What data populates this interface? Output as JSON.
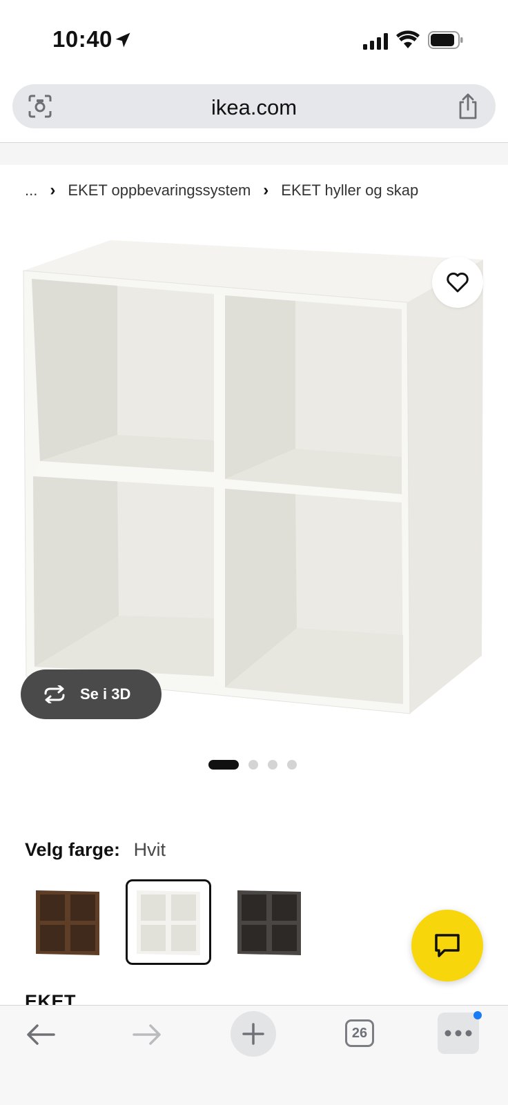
{
  "status_bar": {
    "time": "10:40"
  },
  "browser": {
    "url": "ikea.com",
    "tab_count": "26"
  },
  "breadcrumb": {
    "items": [
      "...",
      "EKET oppbevaringssystem",
      "EKET hyller og skap"
    ],
    "separator": "›"
  },
  "product": {
    "view_3d_label": "Se i 3D",
    "image_count": 4,
    "active_image": 1,
    "color_label": "Velg farge:",
    "color_value": "Hvit",
    "swatches": [
      {
        "name": "walnut",
        "color": "#5e3e27",
        "selected": false
      },
      {
        "name": "white",
        "color": "#ecebe6",
        "selected": true
      },
      {
        "name": "dark-grey",
        "color": "#3f3b38",
        "selected": false
      }
    ],
    "name_peek": "EKET"
  },
  "colors": {
    "chat_yellow": "#f7d60c",
    "badge_blue": "#1a7cf5",
    "pill_dark": "#4a4a4a"
  },
  "icons": [
    "location-arrow-icon",
    "cellular-signal-icon",
    "wifi-icon",
    "battery-icon",
    "camera-lens-icon",
    "share-icon",
    "heart-icon",
    "rotate-3d-icon",
    "chat-icon",
    "back-arrow-icon",
    "forward-arrow-icon",
    "plus-icon",
    "tabs-icon",
    "more-dots-icon"
  ]
}
